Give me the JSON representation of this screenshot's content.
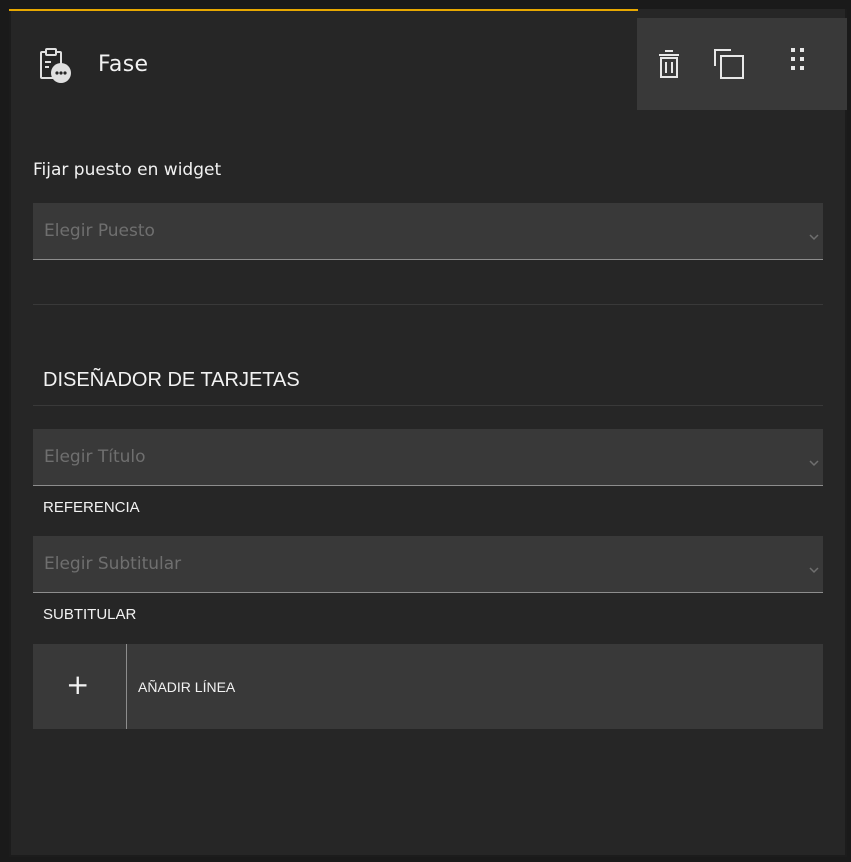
{
  "header": {
    "title": "Fase",
    "icon": "clipboard-chat-icon",
    "accent_color": "#e8a800"
  },
  "toolbar": {
    "delete_icon": "trash-icon",
    "copy_icon": "copy-icon",
    "drag_icon": "drag-handle-icon"
  },
  "fix_post": {
    "label": "Fijar puesto en widget",
    "select_placeholder": "Elegir Puesto"
  },
  "card_designer": {
    "title": "DISEÑADOR DE TARJETAS",
    "title_select_placeholder": "Elegir Título",
    "title_caption": "REFERENCIA",
    "subtitle_select_placeholder": "Elegir Subtitular",
    "subtitle_caption": "SUBTITULAR",
    "add_line_icon": "+",
    "add_line_label": "AÑADIR LÍNEA"
  }
}
